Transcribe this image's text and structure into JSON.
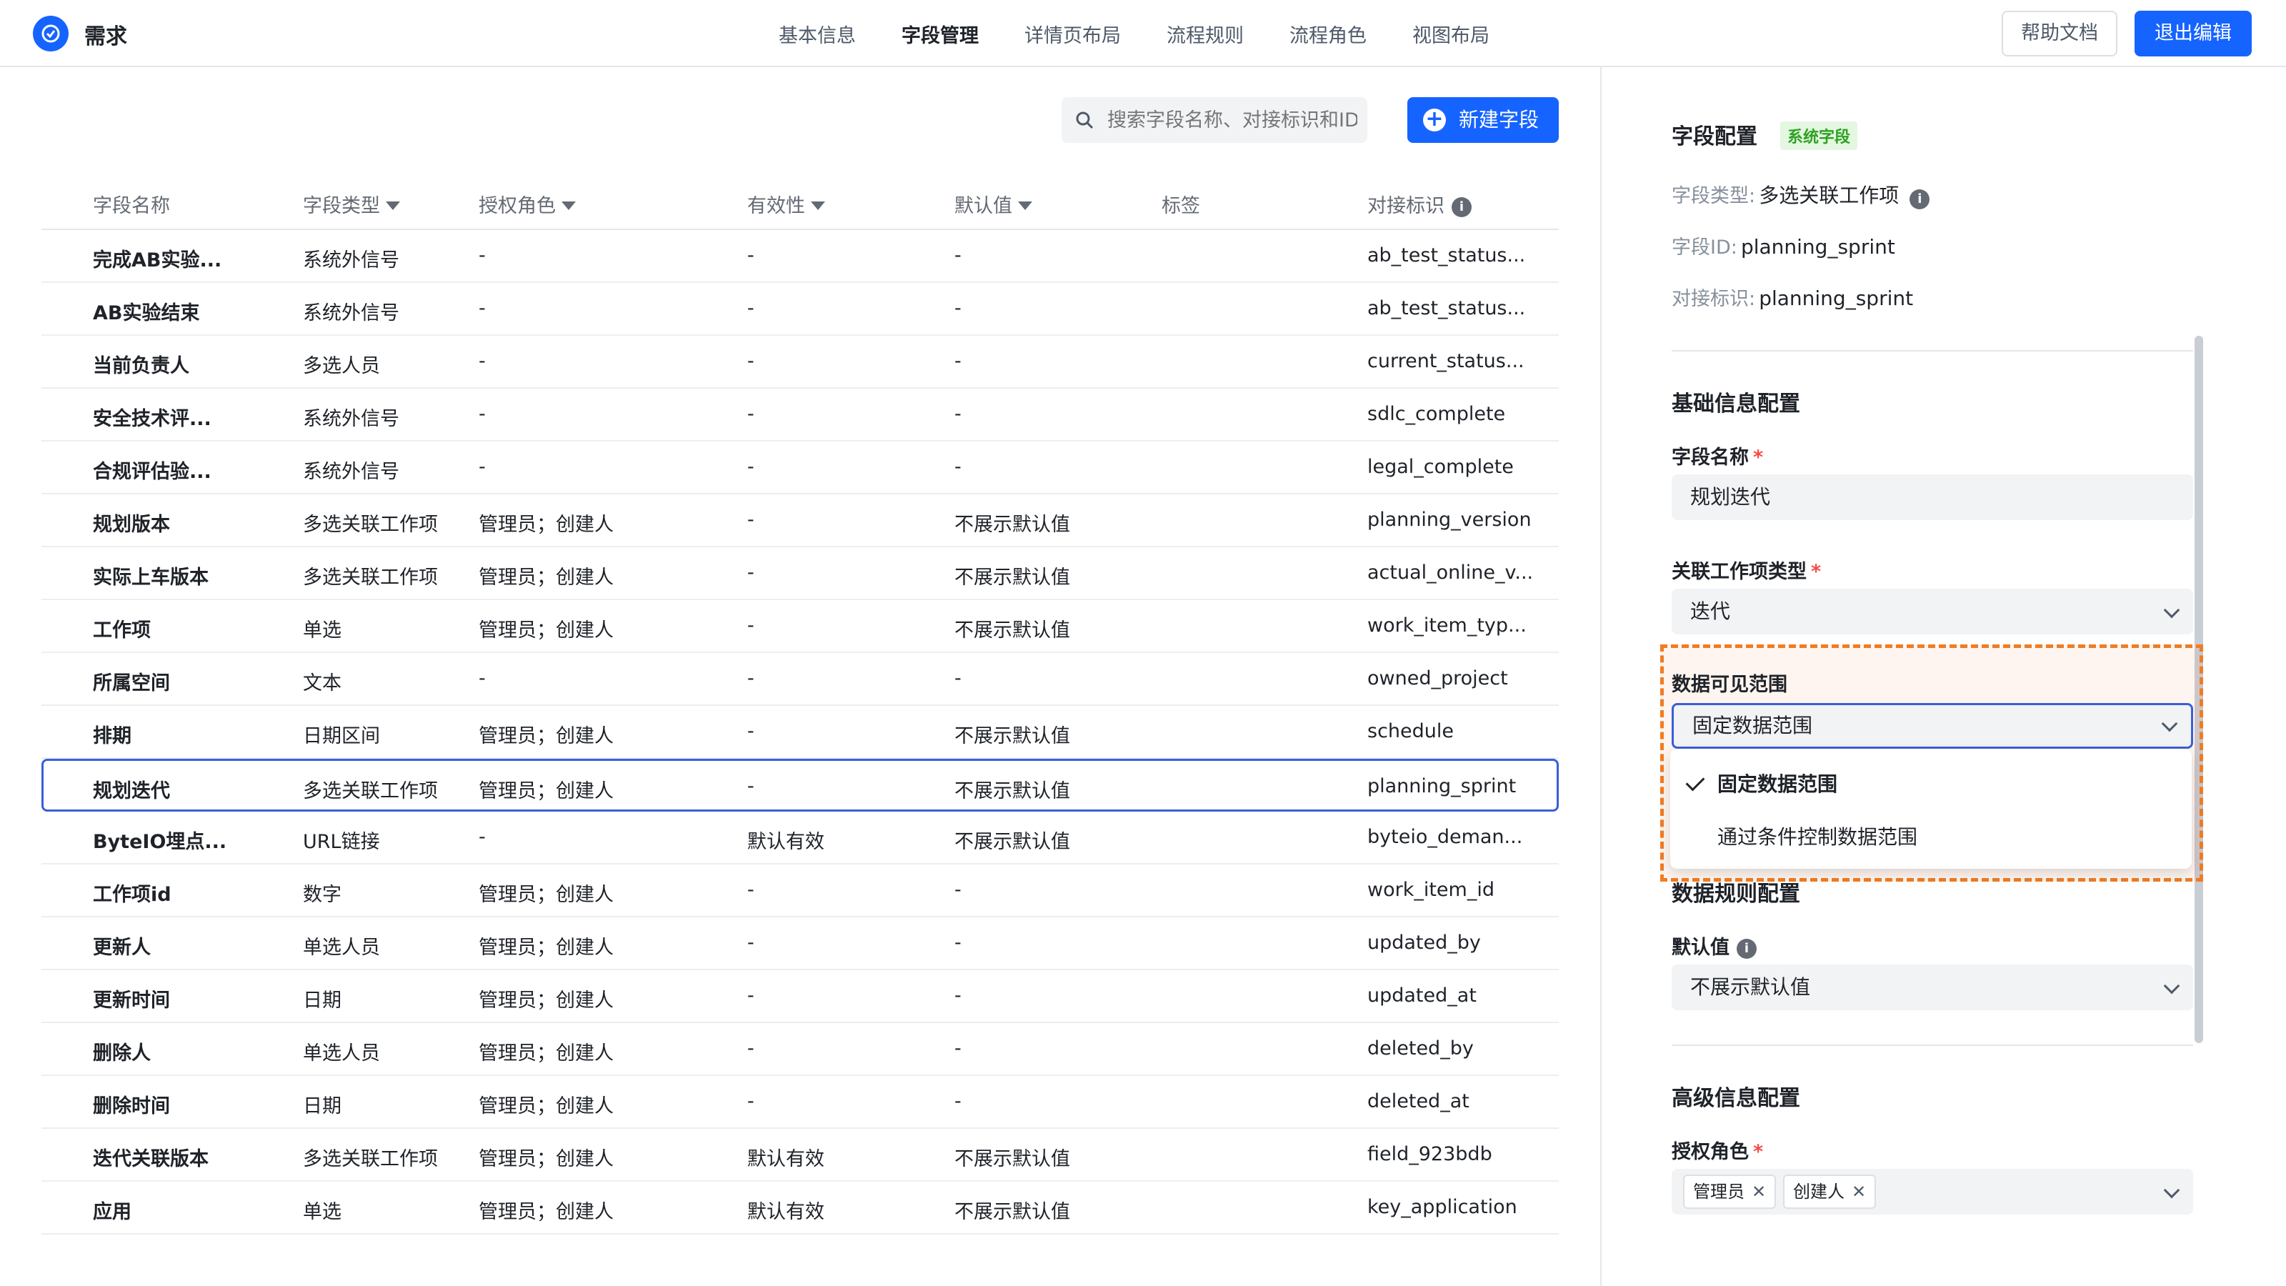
{
  "app": {
    "title": "需求",
    "brand_color": "#1664ff"
  },
  "nav": {
    "items": [
      "基本信息",
      "字段管理",
      "详情页布局",
      "流程规则",
      "流程角色",
      "视图布局"
    ],
    "active": "字段管理"
  },
  "actions": {
    "help": "帮助文档",
    "exit": "退出编辑"
  },
  "toolbar": {
    "search_placeholder": "搜索字段名称、对接标识和ID",
    "new_field": "新建字段"
  },
  "table": {
    "columns": [
      "字段名称",
      "字段类型",
      "授权角色",
      "有效性",
      "默认值",
      "标签",
      "对接标识"
    ],
    "rows": [
      [
        "完成AB实验...",
        "系统外信号",
        "-",
        "-",
        "-",
        "",
        "ab_test_status..."
      ],
      [
        "AB实验结束",
        "系统外信号",
        "-",
        "-",
        "-",
        "",
        "ab_test_status..."
      ],
      [
        "当前负责人",
        "多选人员",
        "-",
        "-",
        "-",
        "",
        "current_status..."
      ],
      [
        "安全技术评...",
        "系统外信号",
        "-",
        "-",
        "-",
        "",
        "sdlc_complete"
      ],
      [
        "合规评估验...",
        "系统外信号",
        "-",
        "-",
        "-",
        "",
        "legal_complete"
      ],
      [
        "规划版本",
        "多选关联工作项",
        "管理员；创建人",
        "-",
        "不展示默认值",
        "",
        "planning_version"
      ],
      [
        "实际上车版本",
        "多选关联工作项",
        "管理员；创建人",
        "-",
        "不展示默认值",
        "",
        "actual_online_v..."
      ],
      [
        "工作项",
        "单选",
        "管理员；创建人",
        "-",
        "不展示默认值",
        "",
        "work_item_typ..."
      ],
      [
        "所属空间",
        "文本",
        "-",
        "-",
        "-",
        "",
        "owned_project"
      ],
      [
        "排期",
        "日期区间",
        "管理员；创建人",
        "-",
        "不展示默认值",
        "",
        "schedule"
      ],
      [
        "规划迭代",
        "多选关联工作项",
        "管理员；创建人",
        "-",
        "不展示默认值",
        "",
        "planning_sprint"
      ],
      [
        "ByteIO埋点...",
        "URL链接",
        "-",
        "默认有效",
        "不展示默认值",
        "",
        "byteio_deman..."
      ],
      [
        "工作项id",
        "数字",
        "管理员；创建人",
        "-",
        "-",
        "",
        "work_item_id"
      ],
      [
        "更新人",
        "单选人员",
        "管理员；创建人",
        "-",
        "-",
        "",
        "updated_by"
      ],
      [
        "更新时间",
        "日期",
        "管理员；创建人",
        "-",
        "-",
        "",
        "updated_at"
      ],
      [
        "删除人",
        "单选人员",
        "管理员；创建人",
        "-",
        "-",
        "",
        "deleted_by"
      ],
      [
        "删除时间",
        "日期",
        "管理员；创建人",
        "-",
        "-",
        "",
        "deleted_at"
      ],
      [
        "迭代关联版本",
        "多选关联工作项",
        "管理员；创建人",
        "默认有效",
        "不展示默认值",
        "",
        "field_923bdb"
      ],
      [
        "应用",
        "单选",
        "管理员；创建人",
        "默认有效",
        "不展示默认值",
        "",
        "key_application"
      ]
    ],
    "selected_index": 10
  },
  "panel": {
    "title": "字段配置",
    "badge": "系统字段",
    "type_label": "字段类型:",
    "type_value": "多选关联工作项",
    "id_label": "字段ID:",
    "id_value": "planning_sprint",
    "key_label": "对接标识:",
    "key_value": "planning_sprint",
    "basic_title": "基础信息配置",
    "name_label": "字段名称",
    "name_value": "规划迭代",
    "rel_label": "关联工作项类型",
    "rel_value": "迭代",
    "scope_label": "数据可见范围",
    "scope_value": "固定数据范围",
    "scope_options": [
      "固定数据范围",
      "通过条件控制数据范围"
    ],
    "rule_title": "数据规则配置",
    "default_label": "默认值",
    "default_value": "不展示默认值",
    "adv_title": "高级信息配置",
    "roles_label": "授权角色",
    "roles": [
      "管理员",
      "创建人"
    ],
    "required_mark": "*"
  }
}
